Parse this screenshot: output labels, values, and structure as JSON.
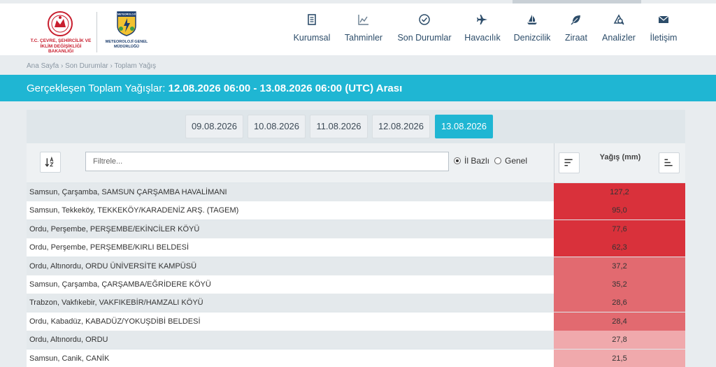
{
  "header": {
    "ministry_logo_text": "T.C. ÇEVRE, ŞEHİRCİLİK VE İKLİM DEĞİŞİKLİĞİ BAKANLIĞI",
    "mgm_badge_text": "METEOROLOJİ",
    "mgm_logo_text": "METEOROLOJİ GENEL MÜDÜRLÜĞÜ",
    "nav": [
      {
        "label": "Kurumsal",
        "icon": "document-icon"
      },
      {
        "label": "Tahminler",
        "icon": "chart-icon"
      },
      {
        "label": "Son Durumlar",
        "icon": "clock-check-icon"
      },
      {
        "label": "Havacılık",
        "icon": "airplane-icon"
      },
      {
        "label": "Denizcilik",
        "icon": "sailboat-icon"
      },
      {
        "label": "Ziraat",
        "icon": "leaf-icon"
      },
      {
        "label": "Analizler",
        "icon": "analysis-icon"
      },
      {
        "label": "İletişim",
        "icon": "envelope-icon"
      }
    ]
  },
  "breadcrumb": {
    "items": [
      "Ana Sayfa",
      "Son Durumlar",
      "Toplam Yağış"
    ],
    "separator": "›"
  },
  "title": {
    "prefix": "Gerçekleşen Toplam Yağışlar:",
    "range": "12.08.2026 06:00 - 13.08.2026 06:00 (UTC) Arası"
  },
  "dates": [
    "09.08.2026",
    "10.08.2026",
    "11.08.2026",
    "12.08.2026",
    "13.08.2026"
  ],
  "selected_date": "13.08.2026",
  "filter": {
    "placeholder": "Filtrele...",
    "value": ""
  },
  "scope": {
    "options": [
      "İl Bazlı",
      "Genel"
    ],
    "selected": "İl Bazlı"
  },
  "value_header": "Yağış (mm)",
  "colors": {
    "accent": "#1fb6d3",
    "high": "#d9313b",
    "mid": "#e26a70",
    "low": "#f0a9ac"
  },
  "rows": [
    {
      "station": "Samsun, Çarşamba, SAMSUN ÇARŞAMBA HAVALİMANI",
      "value": "127,2"
    },
    {
      "station": "Samsun, Tekkeköy, TEKKEKÖY/KARADENİZ ARŞ. (TAGEM)",
      "value": "95,0"
    },
    {
      "station": "Ordu, Perşembe, PERŞEMBE/EKİNCİLER KÖYÜ",
      "value": "77,6"
    },
    {
      "station": "Ordu, Perşembe, PERŞEMBE/KIRLI BELDESİ",
      "value": "62,3"
    },
    {
      "station": "Ordu, Altınordu, ORDU ÜNİVERSİTE KAMPÜSÜ",
      "value": "37,2"
    },
    {
      "station": "Samsun, Çarşamba, ÇARŞAMBA/EĞRİDERE KÖYÜ",
      "value": "35,2"
    },
    {
      "station": "Trabzon, Vakfıkebir, VAKFIKEBİR/HAMZALI KÖYÜ",
      "value": "28,6"
    },
    {
      "station": "Ordu, Kabadüz, KABADÜZ/YOKUŞDİBİ BELDESİ",
      "value": "28,4"
    },
    {
      "station": "Ordu, Altınordu, ORDU",
      "value": "27,8"
    },
    {
      "station": "Samsun, Canik, CANİK",
      "value": "21,5"
    }
  ]
}
